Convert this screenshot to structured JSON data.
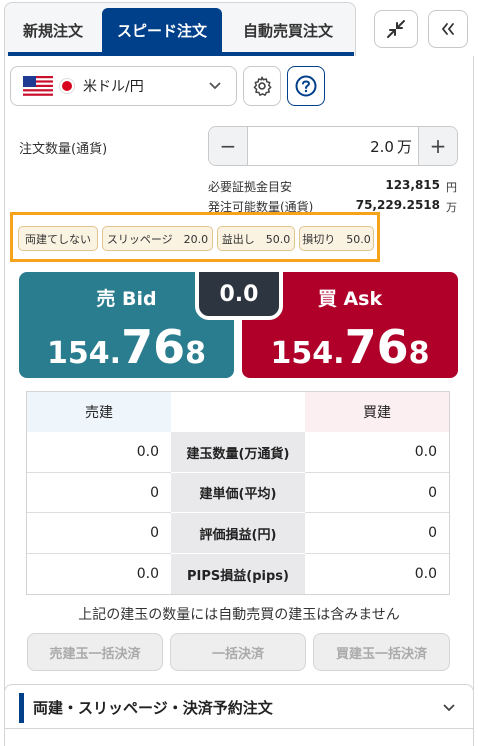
{
  "tabs": [
    {
      "label": "新規注文"
    },
    {
      "label": "スピード注文"
    },
    {
      "label": "自動売買注文"
    }
  ],
  "header_icons": {
    "collapse": "collapse-arrows-icon",
    "chevrons": "double-chevron-left-icon"
  },
  "pair": {
    "label": "米ドル/円",
    "flag_primary": "us-flag-icon",
    "flag_secondary": "japan-flag-icon"
  },
  "toolbar_icons": {
    "settings": "gear-icon",
    "help": "question-icon"
  },
  "order": {
    "qty_label": "注文数量(通貨)",
    "qty_value": "2.0",
    "qty_unit": "万",
    "minus": "−",
    "plus": "+",
    "margin_label": "必要証拠金目安",
    "margin_value": "123,815",
    "margin_unit": "円",
    "orderable_label": "発注可能数量(通貨)",
    "orderable_value": "75,229.2518",
    "orderable_unit": "万"
  },
  "chips": [
    {
      "label": "両建てしない"
    },
    {
      "label": "スリッページ　20.0"
    },
    {
      "label": "益出し　50.0"
    },
    {
      "label": "損切り　50.0"
    }
  ],
  "quote": {
    "bid": {
      "label": "売 Bid",
      "prefix": "154.",
      "big": "76",
      "suffix": "8"
    },
    "ask": {
      "label": "買 Ask",
      "prefix": "154.",
      "big": "76",
      "suffix": "8"
    },
    "spread": "0.0"
  },
  "positions": {
    "sell_header": "売建",
    "buy_header": "買建",
    "rows": [
      {
        "label": "建玉数量(万通貨)",
        "sell": "0.0",
        "buy": "0.0"
      },
      {
        "label": "建単価(平均)",
        "sell": "0",
        "buy": "0"
      },
      {
        "label": "評価損益(円)",
        "sell": "0",
        "buy": "0"
      },
      {
        "label": "PIPS損益(pips)",
        "sell": "0.0",
        "buy": "0.0"
      }
    ]
  },
  "note": "上記の建玉の数量には自動売買の建玉は含みません",
  "settle_buttons": [
    {
      "label": "売建玉一括決済"
    },
    {
      "label": "一括決済"
    },
    {
      "label": "買建玉一括決済"
    }
  ],
  "section": {
    "title": "両建・スリッページ・決済予約注文"
  },
  "colors": {
    "primary": "#003f8a",
    "bid": "#2a7c8f",
    "ask": "#b0002a",
    "highlight": "#f7a21b"
  }
}
